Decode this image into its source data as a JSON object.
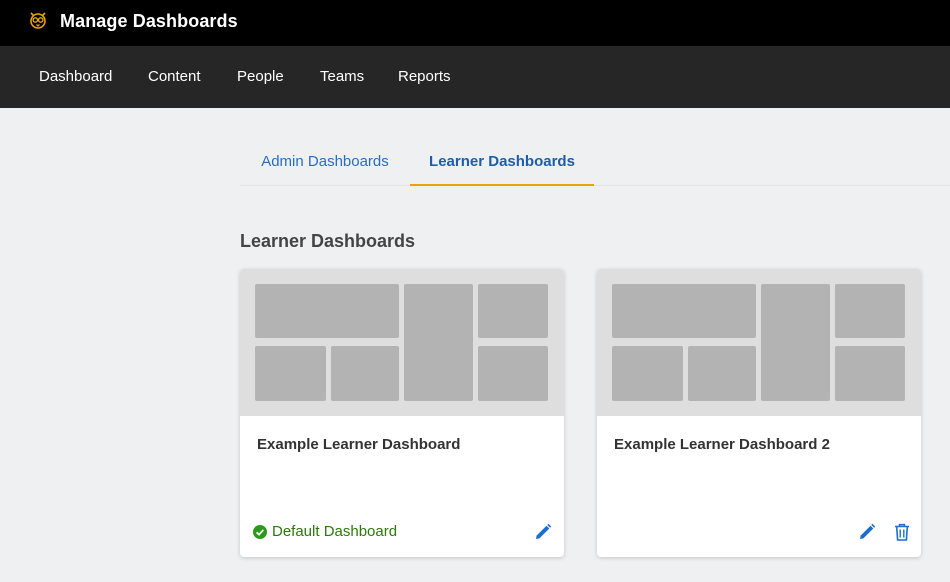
{
  "header": {
    "title": "Manage Dashboards",
    "logo_icon": "owl-logo-icon"
  },
  "nav": {
    "items": [
      "Dashboard",
      "Content",
      "People",
      "Teams",
      "Reports"
    ]
  },
  "tabs": [
    {
      "label": "Admin Dashboards",
      "active": false
    },
    {
      "label": "Learner Dashboards",
      "active": true
    }
  ],
  "section": {
    "title": "Learner Dashboards"
  },
  "cards": [
    {
      "title": "Example Learner Dashboard",
      "default_label": "Default Dashboard",
      "actions": [
        "pencil-icon"
      ]
    },
    {
      "title": "Example Learner Dashboard 2",
      "actions": [
        "pencil-icon",
        "trash-icon"
      ]
    }
  ],
  "colors": {
    "accent": "#e8a400",
    "link": "#2a6ebb",
    "success": "#2b7a0b",
    "topbar": "#000000",
    "navbar": "#262626"
  }
}
